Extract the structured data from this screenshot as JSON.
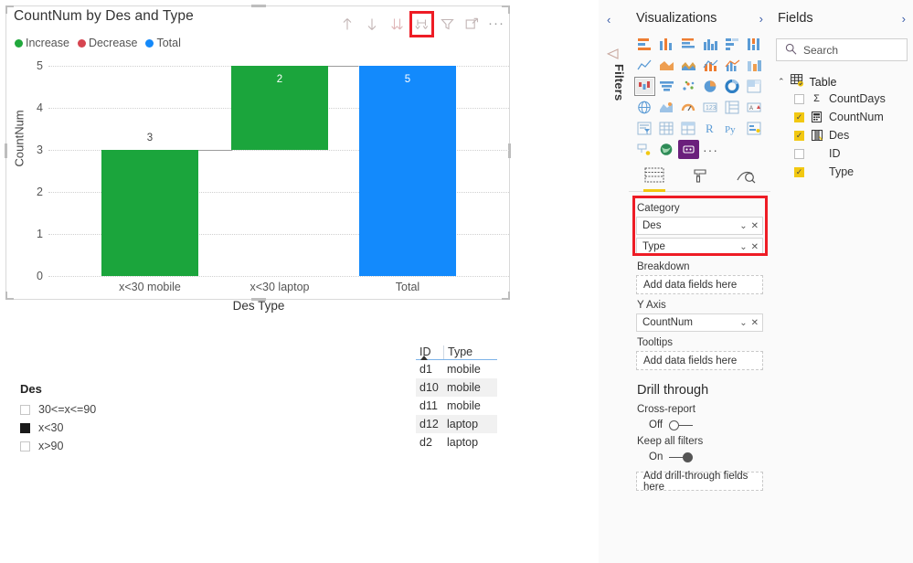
{
  "visual": {
    "title": "CountNum by Des and Type",
    "legend": [
      {
        "label": "Increase",
        "color": "#21a83c"
      },
      {
        "label": "Decrease",
        "color": "#d64550"
      },
      {
        "label": "Total",
        "color": "#1489fa"
      }
    ],
    "toolbar": [
      {
        "name": "drill-up-icon",
        "title": "Drill up"
      },
      {
        "name": "drill-down-icon",
        "title": "Drill down"
      },
      {
        "name": "expand-all-icon",
        "title": "Expand all down one level"
      },
      {
        "name": "drill-mode-icon",
        "title": "Go to next level",
        "highlighted": true
      },
      {
        "name": "filter-icon",
        "title": "Filters"
      },
      {
        "name": "focus-mode-icon",
        "title": "Focus mode"
      },
      {
        "name": "more-options-icon",
        "title": "More options"
      }
    ]
  },
  "chart_data": {
    "type": "bar",
    "subtype": "waterfall",
    "title": "CountNum by Des and Type",
    "xlabel": "Des Type",
    "ylabel": "CountNum",
    "ylim": [
      0,
      5
    ],
    "yticks": [
      0,
      1,
      2,
      3,
      4,
      5
    ],
    "grid": true,
    "legend_position": "top-left",
    "categories": [
      "x<30 mobile",
      "x<30 laptop",
      "Total"
    ],
    "values": [
      3,
      2,
      5
    ],
    "data_labels": [
      "3",
      "2",
      "5"
    ],
    "bars": [
      {
        "category": "x<30 mobile",
        "label": "3",
        "base": 0,
        "top": 3,
        "kind": "increase",
        "color": "#1ba53c"
      },
      {
        "category": "x<30 laptop",
        "label": "2",
        "base": 3,
        "top": 5,
        "kind": "increase",
        "color": "#1ba53c"
      },
      {
        "category": "Total",
        "label": "5",
        "base": 0,
        "top": 5,
        "kind": "total",
        "color": "#138afc"
      }
    ]
  },
  "slicer": {
    "title": "Des",
    "items": [
      {
        "label": "30<=x<=90",
        "selected": false
      },
      {
        "label": "x<30",
        "selected": true
      },
      {
        "label": "x>90",
        "selected": false
      }
    ]
  },
  "table": {
    "columns": [
      "ID",
      "Type"
    ],
    "sorted_column": "ID",
    "sort_direction": "ascending",
    "rows": [
      {
        "ID": "d1",
        "Type": "mobile"
      },
      {
        "ID": "d10",
        "Type": "mobile"
      },
      {
        "ID": "d11",
        "Type": "mobile"
      },
      {
        "ID": "d12",
        "Type": "laptop"
      },
      {
        "ID": "d2",
        "Type": "laptop"
      }
    ]
  },
  "filters_rail": {
    "collapse_label": "‹",
    "label": "Filters"
  },
  "visualizations": {
    "title": "Visualizations",
    "expand_label": "›",
    "icons": [
      "stacked-bar-chart-icon",
      "stacked-column-chart-icon",
      "clustered-bar-chart-icon",
      "clustered-column-chart-icon",
      "100-stacked-bar-chart-icon",
      "100-stacked-column-chart-icon",
      "line-chart-icon",
      "area-chart-icon",
      "stacked-area-chart-icon",
      "line-stacked-column-chart-icon",
      "line-clustered-column-chart-icon",
      "ribbon-chart-icon",
      "waterfall-chart-icon",
      "funnel-chart-icon",
      "scatter-chart-icon",
      "pie-chart-icon",
      "donut-chart-icon",
      "treemap-icon",
      "map-icon",
      "filled-map-icon",
      "gauge-icon",
      "card-icon",
      "multi-row-card-icon",
      "kpi-icon",
      "slicer-icon",
      "table-icon",
      "matrix-icon",
      "r-script-visual-icon",
      "python-visual-icon",
      "key-influencers-icon",
      "decomposition-tree-icon",
      "arcgis-map-icon",
      "paginated-report-icon",
      "more-visuals-icon"
    ],
    "selected_icon": "waterfall-chart-icon",
    "tabs": [
      {
        "name": "fields-tab",
        "active": true
      },
      {
        "name": "format-tab",
        "active": false
      },
      {
        "name": "analytics-tab",
        "active": false
      }
    ],
    "wells": [
      {
        "label": "Category",
        "highlighted": true,
        "chips": [
          {
            "name": "Des"
          },
          {
            "name": "Type"
          }
        ]
      },
      {
        "label": "Breakdown",
        "highlighted": false,
        "placeholder": "Add data fields here",
        "chips": []
      },
      {
        "label": "Y Axis",
        "highlighted": false,
        "chips": [
          {
            "name": "CountNum"
          }
        ]
      },
      {
        "label": "Tooltips",
        "highlighted": false,
        "placeholder": "Add data fields here",
        "chips": []
      }
    ],
    "drill_through": {
      "heading": "Drill through",
      "cross_report": {
        "label": "Cross-report",
        "state": "Off",
        "on": false
      },
      "keep_all_filters": {
        "label": "Keep all filters",
        "state": "On",
        "on": true
      },
      "placeholder": "Add drill-through fields here"
    }
  },
  "fields": {
    "title": "Fields",
    "expand_label": "›",
    "search": {
      "placeholder": "Search",
      "value": "",
      "icon": "search-icon"
    },
    "table_name": "Table",
    "items": [
      {
        "name": "CountDays",
        "checked": false,
        "icon": "sigma-icon"
      },
      {
        "name": "CountNum",
        "checked": true,
        "icon": "measure-icon"
      },
      {
        "name": "Des",
        "checked": true,
        "icon": "calculated-column-icon"
      },
      {
        "name": "ID",
        "checked": false,
        "icon": ""
      },
      {
        "name": "Type",
        "checked": true,
        "icon": ""
      }
    ]
  }
}
